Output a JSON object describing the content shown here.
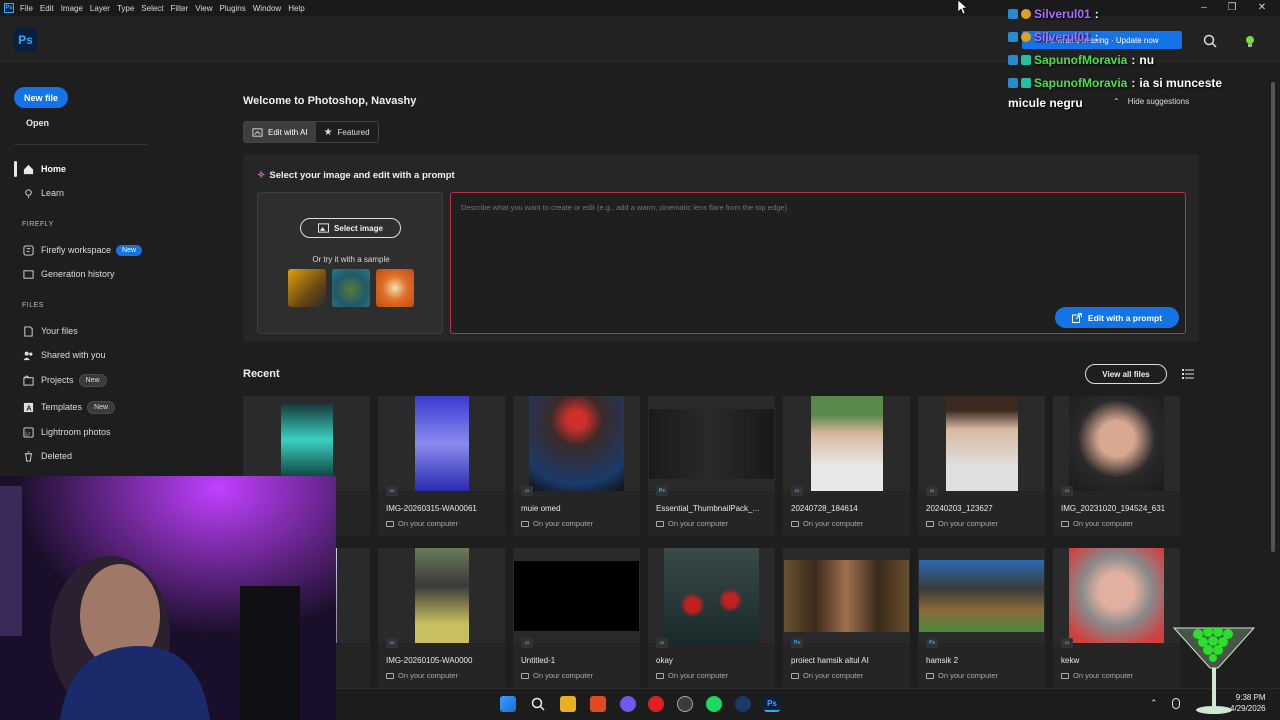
{
  "menubar": {
    "items": [
      "File",
      "Edit",
      "Image",
      "Layer",
      "Type",
      "Select",
      "Filter",
      "View",
      "Plugins",
      "Window",
      "Help"
    ]
  },
  "header": {
    "logo": "Ps",
    "update_button": "Ps what's missing · Update now"
  },
  "sidebar": {
    "new_file": "New file",
    "open": "Open",
    "home": "Home",
    "learn": "Learn",
    "firefly_section": "FIREFLY",
    "firefly_workspace": "Firefly workspace",
    "firefly_badge": "New",
    "generation_history": "Generation history",
    "files_section": "FILES",
    "your_files": "Your files",
    "shared_with_you": "Shared with you",
    "projects": "Projects",
    "projects_badge": "New",
    "templates": "Templates",
    "templates_badge": "New",
    "lightroom_photos": "Lightroom photos",
    "deleted": "Deleted"
  },
  "main": {
    "welcome": "Welcome to Photoshop, Navashy",
    "tabs": [
      {
        "label": "Edit with AI"
      },
      {
        "label": "Featured"
      }
    ],
    "prompt_title": "Select your image and edit with a prompt",
    "select_image": "Select image",
    "sample_label": "Or try it with a sample",
    "prompt_placeholder": "Describe what you want to create or edit (e.g., add a warm, cinematic lens flare from the top edge).",
    "edit_with_prompt": "Edit with a prompt",
    "recent_title": "Recent",
    "view_all": "View all files",
    "location_label": "On your computer"
  },
  "recent_files": [
    {
      "name": "IMG-20260315-WA00061",
      "type": "img"
    },
    {
      "name": "muie omed",
      "type": "img"
    },
    {
      "name": "Essential_ThumbnailPack_...",
      "type": "Ps"
    },
    {
      "name": "20240728_184614",
      "type": "img"
    },
    {
      "name": "20240203_123627",
      "type": "img"
    },
    {
      "name": "IMG_20231020_194524_631",
      "type": "img"
    },
    {
      "name": "IMG-20260105-WA0000",
      "type": "img"
    },
    {
      "name": "Untitled-1",
      "type": "img"
    },
    {
      "name": "okay",
      "type": "img"
    },
    {
      "name": "proiect hamsik altul AI",
      "type": "Ps"
    },
    {
      "name": "hamsik 2",
      "type": "Ps"
    },
    {
      "name": "kekw",
      "type": "img"
    }
  ],
  "chat": {
    "lines": [
      {
        "user": "Silverul01",
        "message": "",
        "color": "#b06cff"
      },
      {
        "user": "Silverul01",
        "message": "",
        "color": "#b06cff"
      },
      {
        "user": "SapunofMoravia",
        "message": "nu",
        "color": "#4be04b"
      },
      {
        "user": "SapunofMoravia",
        "message": "ia si munceste",
        "color": "#4be04b"
      }
    ],
    "continuation": "micule negru",
    "hide_suggestions": "Hide suggestions"
  },
  "taskbar": {
    "time": "9:38 PM",
    "date": "4/29/2026"
  },
  "colors": {
    "accent": "#1473e6",
    "ps_blue": "#31a8ff",
    "background": "#1e1e1e",
    "prompt_border": "#b8324a"
  }
}
